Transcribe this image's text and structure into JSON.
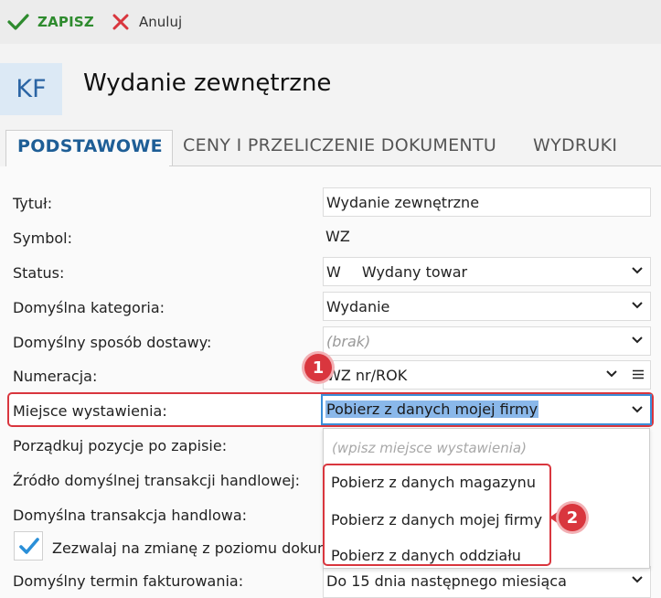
{
  "toolbar": {
    "save_label": "ZAPISZ",
    "cancel_label": "Anuluj"
  },
  "header": {
    "badge": "KF",
    "title": "Wydanie zewnętrzne"
  },
  "tabs": [
    {
      "label": "PODSTAWOWE"
    },
    {
      "label": "CENY I PRZELICZENIE DOKUMENTU"
    },
    {
      "label": "WYDRUKI"
    }
  ],
  "form": {
    "tytul": {
      "label": "Tytuł:",
      "value": "Wydanie zewnętrzne"
    },
    "symbol": {
      "label": "Symbol:",
      "value": "WZ"
    },
    "status": {
      "label": "Status:",
      "code": "W",
      "value": "Wydany towar"
    },
    "kategoria": {
      "label": "Domyślna kategoria:",
      "value": "Wydanie"
    },
    "dostawa": {
      "label": "Domyślny sposób dostawy:",
      "placeholder": "(brak)"
    },
    "numeracja": {
      "label": "Numeracja:",
      "value": "WZ nr/ROK"
    },
    "miejsce": {
      "label": "Miejsce wystawienia:",
      "value": "Pobierz z danych mojej firmy"
    },
    "porzadkuj": {
      "label": "Porządkuj pozycje po zapisie:"
    },
    "zrodlo": {
      "label": "Źródło domyślnej transakcji handlowej:"
    },
    "transakcja": {
      "label": "Domyślna transakcja handlowa:"
    },
    "zezwalaj": {
      "label": "Zezwalaj na zmianę z poziomu dokum",
      "checked": true
    },
    "termin": {
      "label": "Domyślny termin fakturowania:",
      "value": "Do 15 dnia następnego miesiąca"
    }
  },
  "dropdown": {
    "placeholder": "(wpisz miejsce wystawienia)",
    "options": [
      "Pobierz z danych magazynu",
      "Pobierz z danych mojej firmy",
      "Pobierz z danych oddziału"
    ]
  },
  "markers": {
    "first": "1",
    "second": "2"
  },
  "colors": {
    "accent": "#1e5e96",
    "save": "#2e8b2e",
    "cancel": "#d9363e",
    "annotation": "#d9363e",
    "selection": "#8ab8ea"
  }
}
